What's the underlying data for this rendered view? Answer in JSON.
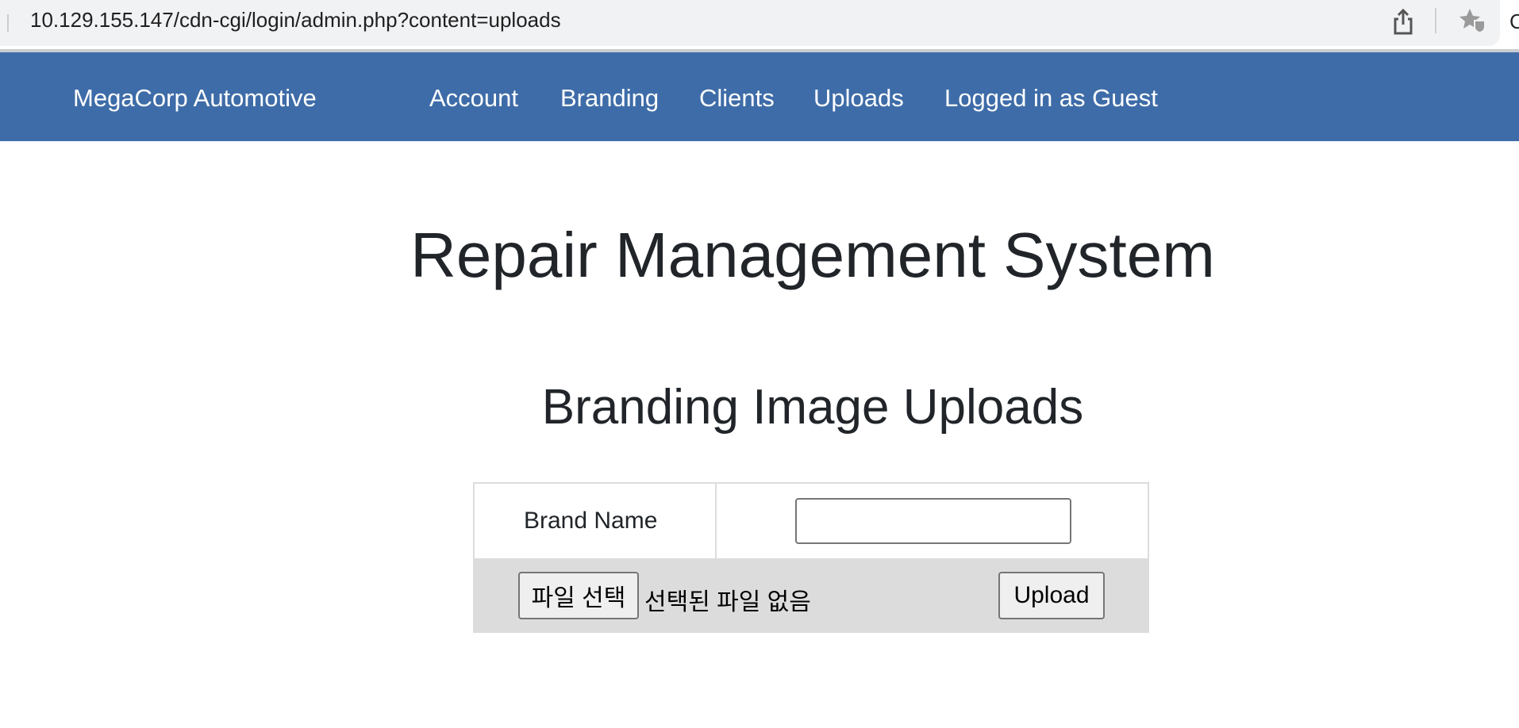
{
  "browser": {
    "url": "10.129.155.147/cdn-cgi/login/admin.php?content=uploads",
    "icons": [
      "share-icon",
      "favorites-star-icon"
    ],
    "edge_char": "C"
  },
  "nav": {
    "brand": "MegaCorp Automotive",
    "items": [
      {
        "label": "Account"
      },
      {
        "label": "Branding"
      },
      {
        "label": "Clients"
      },
      {
        "label": "Uploads"
      },
      {
        "label": "Logged in as Guest"
      }
    ],
    "color": "#3e6ca8"
  },
  "main": {
    "title": "Repair Management System",
    "subtitle": "Branding Image Uploads"
  },
  "form": {
    "brand_label": "Brand Name",
    "brand_value": "",
    "file_button": "파일 선택",
    "file_status": "선택된 파일 없음",
    "upload_label": "Upload"
  }
}
